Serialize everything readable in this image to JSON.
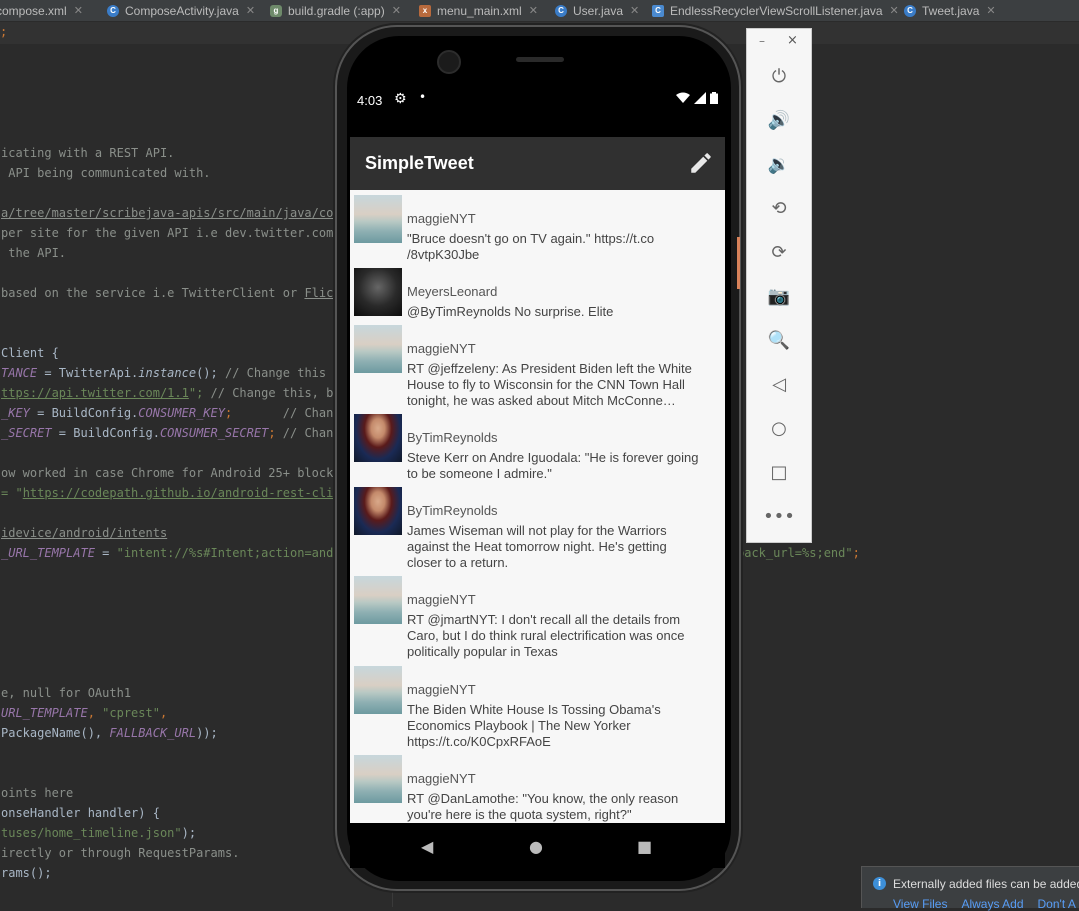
{
  "tabs": [
    {
      "label": "compose.xml",
      "icon": "xml-file-icon"
    },
    {
      "label": "ComposeActivity.java",
      "icon": "java-class-icon"
    },
    {
      "label": "build.gradle (:app)",
      "icon": "gradle-icon"
    },
    {
      "label": "menu_main.xml",
      "icon": "xml-file-icon"
    },
    {
      "label": "User.java",
      "icon": "java-class-icon"
    },
    {
      "label": "EndlessRecyclerViewScrollListener.java",
      "icon": "java-class-icon"
    },
    {
      "label": "Tweet.java",
      "icon": "java-class-icon"
    }
  ],
  "editor": {
    "line_semicolon": ";",
    "c1": "icating with a REST API.",
    "c2": " API being communicated with.",
    "c3": "a/tree/master/scribejava-apis/src/main/java/com/",
    "c4": "per site for the given API i.e dev.twitter.com",
    "c5": " the API.",
    "c6a": "based on the service i.e TwitterClient or ",
    "c6b": "Flickr",
    "l7": "Client {",
    "l8a": "TANCE",
    "l8b": " = TwitterApi.",
    "l8c": "instance",
    "l8d": "(); ",
    "l8e": "// Change this",
    "l9a": "ttps://api.twitter.com/1.1",
    "l9b": "\"; ",
    "l9c": "// Change this, bas",
    "l10a": "_KEY",
    "l10b": " = BuildConfig.",
    "l10c": "CONSUMER_KEY",
    "l10d": ";       ",
    "l10e": "// Change",
    "l11a": "_SECRET",
    "l11b": " = BuildConfig.",
    "l11c": "CONSUMER_SECRET",
    "l11d": "; ",
    "l11e": "// Change",
    "l12": "ow worked in case Chrome for Android 25+ blocks",
    "l13a": "= \"",
    "l13b": "https://codepath.github.io/android-rest-clien",
    "l14": "idevice/android/intents",
    "l15a": "_URL_TEMPLATE",
    "l15b": " = ",
    "l15c": "\"intent://%s#Intent;action=andro",
    "l15d": "back_url=%s;end\"",
    "l15e": ";",
    "l16": "e, null for OAuth1",
    "l17a": "URL_TEMPLATE",
    "l17b": ", ",
    "l17c": "\"cprest\"",
    "l17d": ",",
    "l18a": "PackageName(), ",
    "l18b": "FALLBACK_URL",
    "l18c": "));",
    "l19": "oints here",
    "l20": "onseHandler handler) {",
    "l21a": "tuses/home_timeline.json\"",
    "l21b": ");",
    "l22": "irectly or through RequestParams.",
    "l23": "rams();"
  },
  "device": {
    "status": {
      "time": "4:03",
      "icons": [
        "settings-icon",
        "notification-dot-icon",
        "wifi-icon",
        "signal-icon",
        "battery-icon"
      ]
    },
    "app_title": "SimpleTweet",
    "compose_icon": "edit-pencil-icon",
    "tweets": [
      {
        "user": "maggieNYT",
        "body": "\"Bruce doesn't go on TV again.\" https://t.co\n/8vtpK30Jbe",
        "avatar": "sea"
      },
      {
        "user": "MeyersLeonard",
        "body": "@ByTimReynolds No surprise. Elite",
        "avatar": "dark"
      },
      {
        "user": "maggieNYT",
        "body": "RT @jeffzeleny: As President Biden left the White\nHouse to fly to Wisconsin for the CNN Town Hall\ntonight, he was asked about Mitch McConne…",
        "avatar": "sea"
      },
      {
        "user": "ByTimReynolds",
        "body": "Steve Kerr on Andre Iguodala: \"He is forever going\nto be someone I admire.\"",
        "avatar": "suit"
      },
      {
        "user": "ByTimReynolds",
        "body": "James Wiseman will not play for the Warriors\nagainst the Heat tomorrow night. He's getting\ncloser to a return.",
        "avatar": "suit"
      },
      {
        "user": "maggieNYT",
        "body": "RT @jmartNYT: I don't recall all the details from\nCaro, but I do think rural electrification was once\npolitically popular in Texas",
        "avatar": "sea"
      },
      {
        "user": "maggieNYT",
        "body": "The Biden White House Is Tossing Obama's\nEconomics Playbook | The New Yorker\nhttps://t.co/K0CpxRFAoE",
        "avatar": "sea"
      },
      {
        "user": "maggieNYT",
        "body": "RT @DanLamothe: \"You know, the only reason\nyou're here is the quota system, right?\"",
        "avatar": "sea"
      }
    ]
  },
  "emulator_panel": {
    "minimize": "–",
    "close": "×",
    "buttons": [
      "power-icon",
      "volume-up-icon",
      "volume-down-icon",
      "rotate-left-icon",
      "rotate-right-icon",
      "camera-icon",
      "zoom-icon",
      "back-icon",
      "home-icon",
      "overview-icon",
      "more-icon"
    ]
  },
  "notification": {
    "text": "Externally added files can be added",
    "links": [
      "View Files",
      "Always Add",
      "Don't A"
    ]
  }
}
